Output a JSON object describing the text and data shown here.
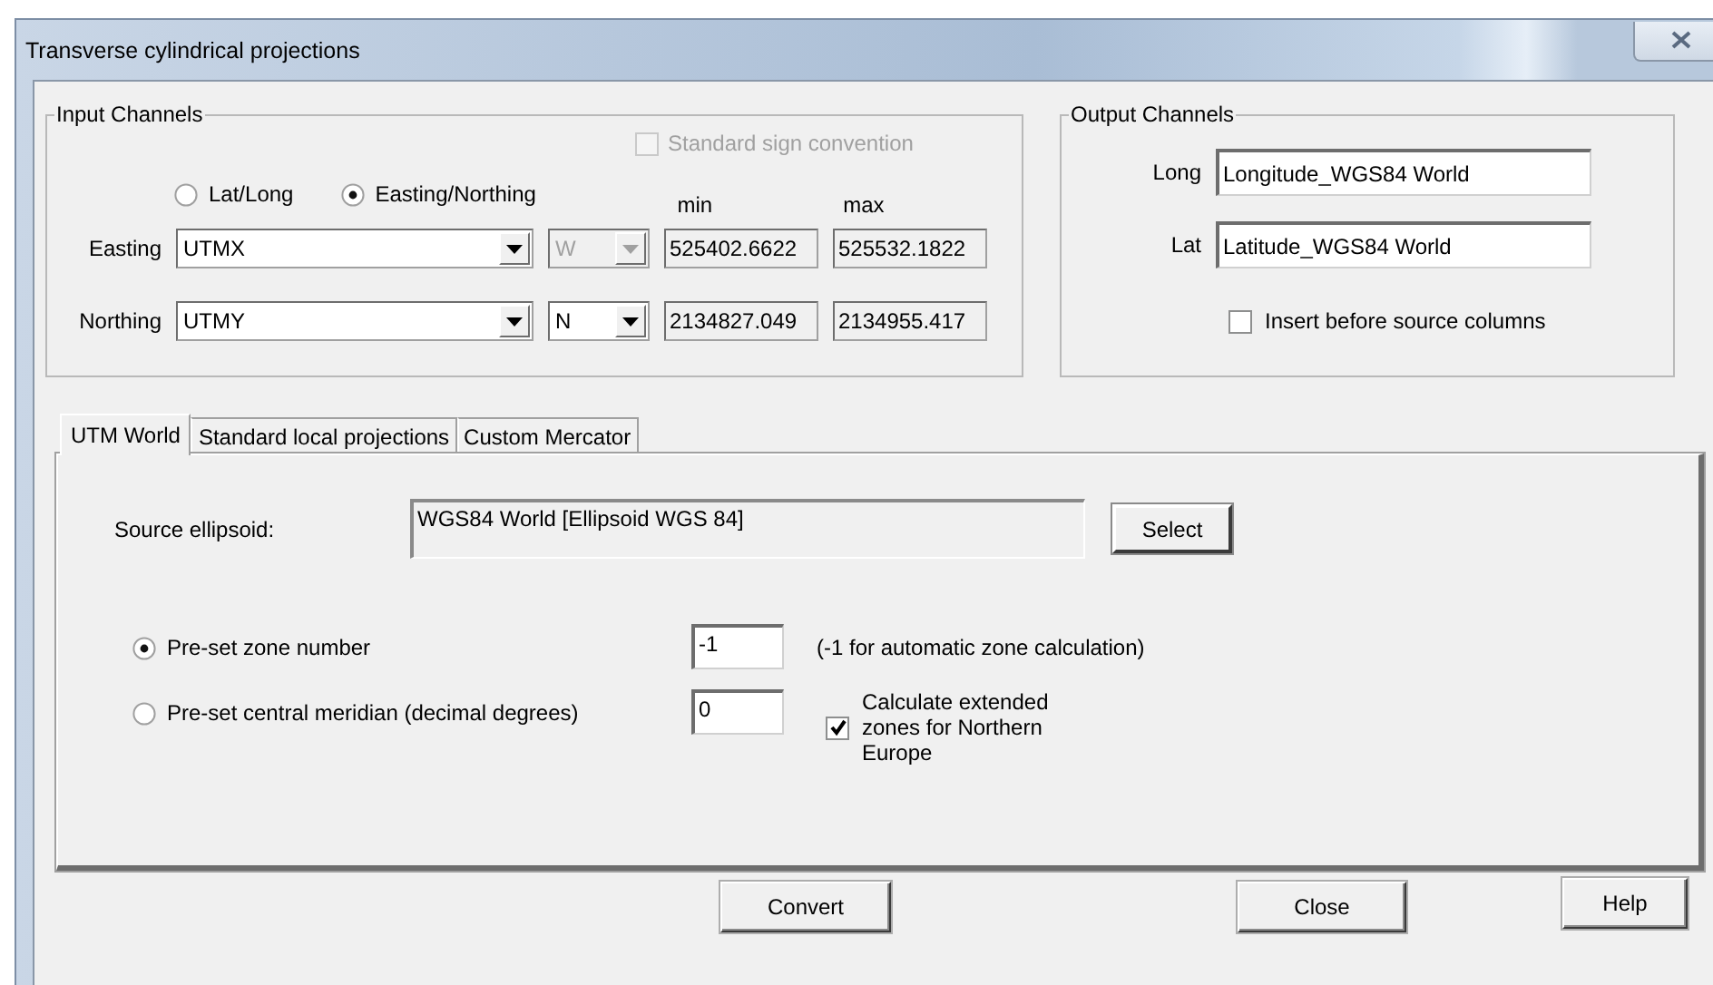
{
  "window": {
    "title": "Transverse cylindrical projections"
  },
  "input_channels": {
    "title": "Input Channels",
    "sign_convention": {
      "label": "Standard sign convention",
      "checked": false,
      "disabled": true
    },
    "mode_options": [
      {
        "label": "Lat/Long",
        "selected": false
      },
      {
        "label": "Easting/Northing",
        "selected": true
      }
    ],
    "column_headers": [
      "min",
      "max"
    ],
    "rows": [
      {
        "label": "Easting",
        "column": "UTMX",
        "hemisphere": "W",
        "hemisphere_disabled": true,
        "min": "525402.6622",
        "max": "525532.1822"
      },
      {
        "label": "Northing",
        "column": "UTMY",
        "hemisphere": "N",
        "hemisphere_disabled": false,
        "min": "2134827.049",
        "max": "2134955.417"
      }
    ]
  },
  "output_channels": {
    "title": "Output  Channels",
    "fields": [
      {
        "label": "Long",
        "value": "Longitude_WGS84 World"
      },
      {
        "label": "Lat",
        "value": "Latitude_WGS84 World"
      }
    ],
    "insert_before": {
      "label": "Insert before source columns",
      "checked": false
    }
  },
  "tabs": [
    {
      "label": "UTM World",
      "selected": true
    },
    {
      "label": "Standard local projections",
      "selected": false
    },
    {
      "label": "Custom Mercator",
      "selected": false
    }
  ],
  "utm_world": {
    "source_label": "Source ellipsoid:",
    "source_value": "WGS84 World [Ellipsoid WGS 84]",
    "select_button": "Select",
    "zone_options": [
      {
        "label": "Pre-set zone number",
        "selected": true,
        "value": "-1"
      },
      {
        "label": "Pre-set central meridian (decimal degrees)",
        "selected": false,
        "value": "0"
      }
    ],
    "zone_hint": "(-1 for automatic zone calculation)",
    "extended": {
      "label": "Calculate extended zones for Northern Europe",
      "checked": true
    }
  },
  "buttons": [
    {
      "label": "Convert"
    },
    {
      "label": "Close"
    },
    {
      "label": "Help"
    }
  ]
}
